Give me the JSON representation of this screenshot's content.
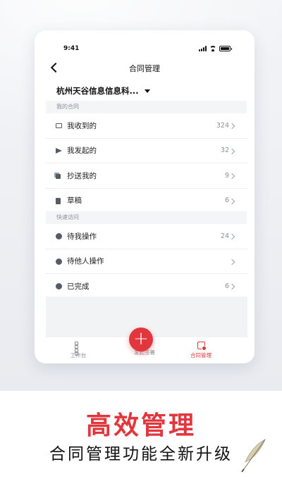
{
  "status_bar": {
    "time": "9:41"
  },
  "nav": {
    "title": "合同管理"
  },
  "company": {
    "name": "杭州天谷信息信息科..."
  },
  "sections": [
    {
      "title": "我的合同",
      "items": [
        {
          "icon": "inbox-icon",
          "label": "我收到的",
          "count": "324"
        },
        {
          "icon": "send-icon",
          "label": "我发起的",
          "count": "32"
        },
        {
          "icon": "copy-icon",
          "label": "抄送我的",
          "count": "9"
        },
        {
          "icon": "draft-icon",
          "label": "草稿",
          "count": "6"
        }
      ]
    },
    {
      "title": "快速访问",
      "items": [
        {
          "icon": "clock-icon",
          "label": "待我操作",
          "count": "24"
        },
        {
          "icon": "more-dots-icon",
          "label": "待他人操作",
          "count": ""
        },
        {
          "icon": "check-circle-icon",
          "label": "已完成",
          "count": "6"
        }
      ]
    }
  ],
  "tabbar": {
    "work_label": "工作台",
    "sign_label": "发起签署",
    "contract_label": "合同管理",
    "fab_symbol": "+"
  },
  "promo": {
    "headline": "高效管理",
    "subline": "合同管理功能全新升级"
  },
  "colors": {
    "accent": "#e0363c",
    "muted": "#8b8f97"
  }
}
